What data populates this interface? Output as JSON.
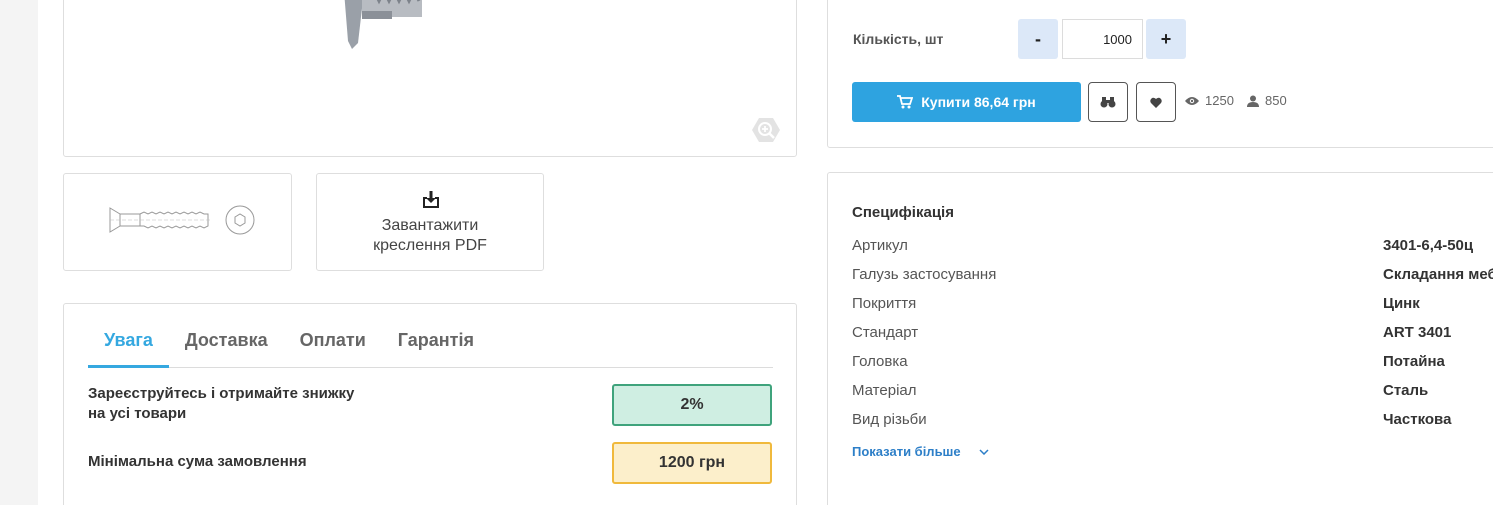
{
  "pdf": {
    "label_line1": "Завантажити",
    "label_line2": "креслення PDF"
  },
  "tabs": [
    {
      "label": "Увага"
    },
    {
      "label": "Доставка"
    },
    {
      "label": "Оплати"
    },
    {
      "label": "Гарантія"
    }
  ],
  "info": {
    "register_line1": "Зареєструйтесь і отримайте знижку",
    "register_line2": "на усі товари",
    "discount": "2%",
    "min_order_label": "Мінімальна сума замовлення",
    "min_order_value": "1200 грн"
  },
  "purchase": {
    "qty_label": "Кількість, шт",
    "minus": "-",
    "plus": "+",
    "qty_value": "1000",
    "buy_label": "Купити 86,64 грн",
    "views": "1250",
    "buyers": "850"
  },
  "spec": {
    "title": "Специфікація",
    "rows": [
      {
        "key": "Артикул",
        "value": "3401-6,4-50ц"
      },
      {
        "key": "Галузь застосування",
        "value": "Складання меб"
      },
      {
        "key": "Покриття",
        "value": "Цинк"
      },
      {
        "key": "Стандарт",
        "value": "ART 3401"
      },
      {
        "key": "Головка",
        "value": "Потайна"
      },
      {
        "key": "Матеріал",
        "value": "Сталь"
      },
      {
        "key": "Вид різьби",
        "value": "Часткова"
      }
    ],
    "show_more": "Показати більше"
  },
  "colors": {
    "accent": "#2ea3e0",
    "tab_active": "#35a8e0",
    "link": "#2d7fc8",
    "badge_green": "#cfeee2",
    "badge_yellow": "#fcefcb"
  },
  "icons": [
    "zoom-icon",
    "download-icon",
    "cart-icon",
    "compare-icon",
    "heart-icon",
    "eye-icon",
    "user-icon",
    "chevron-down-icon"
  ]
}
